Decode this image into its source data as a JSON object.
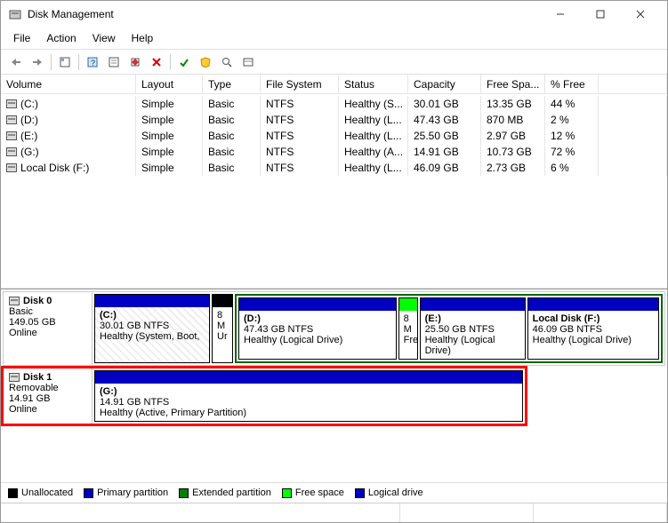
{
  "window": {
    "title": "Disk Management"
  },
  "menubar": [
    "File",
    "Action",
    "View",
    "Help"
  ],
  "columns": [
    "Volume",
    "Layout",
    "Type",
    "File System",
    "Status",
    "Capacity",
    "Free Spa...",
    "% Free"
  ],
  "volumes": [
    {
      "name": "(C:)",
      "layout": "Simple",
      "type": "Basic",
      "fs": "NTFS",
      "status": "Healthy (S...",
      "capacity": "30.01 GB",
      "free": "13.35 GB",
      "pct": "44 %"
    },
    {
      "name": "(D:)",
      "layout": "Simple",
      "type": "Basic",
      "fs": "NTFS",
      "status": "Healthy (L...",
      "capacity": "47.43 GB",
      "free": "870 MB",
      "pct": "2 %"
    },
    {
      "name": "(E:)",
      "layout": "Simple",
      "type": "Basic",
      "fs": "NTFS",
      "status": "Healthy (L...",
      "capacity": "25.50 GB",
      "free": "2.97 GB",
      "pct": "12 %"
    },
    {
      "name": "(G:)",
      "layout": "Simple",
      "type": "Basic",
      "fs": "NTFS",
      "status": "Healthy (A...",
      "capacity": "14.91 GB",
      "free": "10.73 GB",
      "pct": "72 %"
    },
    {
      "name": "Local Disk  (F:)",
      "layout": "Simple",
      "type": "Basic",
      "fs": "NTFS",
      "status": "Healthy (L...",
      "capacity": "46.09 GB",
      "free": "2.73 GB",
      "pct": "6 %"
    }
  ],
  "disks": {
    "disk0": {
      "name": "Disk 0",
      "type": "Basic",
      "size": "149.05 GB",
      "status": "Online"
    },
    "disk1": {
      "name": "Disk 1",
      "type": "Removable",
      "size": "14.91 GB",
      "status": "Online"
    }
  },
  "partitions": {
    "c": {
      "name": "(C:)",
      "info": "30.01 GB NTFS",
      "health": "Healthy (System, Boot,"
    },
    "un": {
      "name": "",
      "info": "8 M",
      "health": "Ur"
    },
    "d": {
      "name": "(D:)",
      "info": "47.43 GB NTFS",
      "health": "Healthy (Logical Drive)"
    },
    "fs": {
      "name": "",
      "info": "8 M",
      "health": "Fre"
    },
    "e": {
      "name": "(E:)",
      "info": "25.50 GB NTFS",
      "health": "Healthy (Logical Drive)"
    },
    "f": {
      "name": "Local Disk   (F:)",
      "info": "46.09 GB NTFS",
      "health": "Healthy (Logical Drive)"
    },
    "g": {
      "name": "(G:)",
      "info": "14.91 GB NTFS",
      "health": "Healthy (Active, Primary Partition)"
    }
  },
  "legend": {
    "unallocated": "Unallocated",
    "primary": "Primary partition",
    "extended": "Extended partition",
    "freespace": "Free space",
    "logical": "Logical drive"
  }
}
